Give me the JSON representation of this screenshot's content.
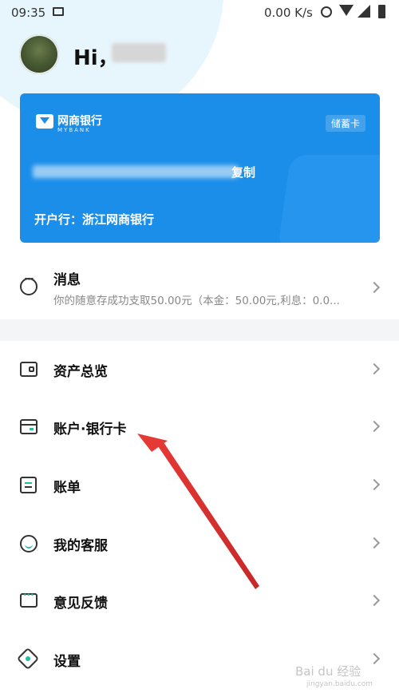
{
  "status_bar": {
    "time": "09:35",
    "network_speed": "0.00 K/s",
    "icons": [
      "image-icon",
      "alarm-icon",
      "wifi-icon",
      "signal-icon",
      "battery-icon"
    ]
  },
  "header": {
    "greeting": "Hi，",
    "username_hidden": true
  },
  "card": {
    "bank_name": "网商银行",
    "bank_name_en": "MYBANK",
    "card_type": "储蓄卡",
    "copy_label": "复制",
    "branch_label": "开户行：浙江网商银行",
    "accent_color": "#1b8ee9"
  },
  "message": {
    "title": "消息",
    "preview": "你的随意存成功支取50.00元（本金：50.00元,利息：0.0..."
  },
  "menu": [
    {
      "label": "资产总览",
      "icon": "wallet-icon"
    },
    {
      "label": "账户·银行卡",
      "icon": "bank-card-icon"
    },
    {
      "label": "账单",
      "icon": "bill-icon"
    },
    {
      "label": "我的客服",
      "icon": "customer-service-icon"
    },
    {
      "label": "意见反馈",
      "icon": "feedback-icon"
    },
    {
      "label": "设置",
      "icon": "settings-icon"
    }
  ],
  "watermark": {
    "text": "Bai du 经验",
    "sub": "jingyan.baidu.com"
  },
  "colors": {
    "accent_teal": "#1fbfa6",
    "arrow_red": "#e53935"
  }
}
